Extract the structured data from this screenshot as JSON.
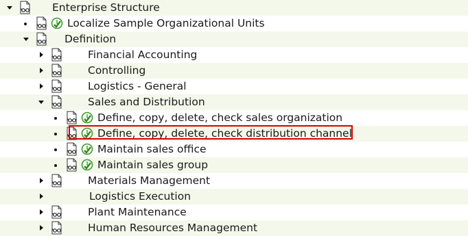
{
  "tree": {
    "root": {
      "label": "Enterprise Structure",
      "icon": "document-glasses-icon",
      "state": "expanded"
    },
    "items": [
      {
        "id": "localize",
        "label": "Localize Sample Organizational Units",
        "toggle": "leaf",
        "icon": "document-glasses-icon",
        "execute_icon": "execute-clock-check-icon"
      },
      {
        "id": "definition",
        "label": "Definition",
        "toggle": "expanded",
        "icon": "document-glasses-icon"
      },
      {
        "id": "financial-accounting",
        "label": "Financial Accounting",
        "toggle": "collapsed",
        "icon": "document-glasses-icon"
      },
      {
        "id": "controlling",
        "label": "Controlling",
        "toggle": "collapsed",
        "icon": "document-glasses-icon"
      },
      {
        "id": "logistics-general",
        "label": "Logistics - General",
        "toggle": "collapsed",
        "icon": "document-glasses-icon"
      },
      {
        "id": "sales-distribution",
        "label": "Sales and Distribution",
        "toggle": "expanded",
        "icon": "document-glasses-icon"
      },
      {
        "id": "define-sales-org",
        "label": "Define, copy, delete, check sales organization",
        "toggle": "leaf",
        "icon": "document-glasses-icon",
        "execute_icon": "execute-clock-check-icon"
      },
      {
        "id": "define-distribution-channel",
        "label": "Define, copy, delete, check distribution channel",
        "toggle": "leaf",
        "icon": "document-glasses-icon",
        "execute_icon": "execute-clock-check-icon",
        "highlighted": true
      },
      {
        "id": "maintain-sales-office",
        "label": "Maintain sales office",
        "toggle": "leaf",
        "icon": "document-glasses-icon",
        "execute_icon": "execute-clock-check-icon"
      },
      {
        "id": "maintain-sales-group",
        "label": "Maintain sales group",
        "toggle": "leaf",
        "icon": "document-glasses-icon",
        "execute_icon": "execute-clock-check-icon"
      },
      {
        "id": "materials-management",
        "label": "Materials Management",
        "toggle": "collapsed",
        "icon": "document-glasses-icon"
      },
      {
        "id": "logistics-execution",
        "label": "Logistics Execution",
        "toggle": "collapsed"
      },
      {
        "id": "plant-maintenance",
        "label": "Plant Maintenance",
        "toggle": "collapsed",
        "icon": "document-glasses-icon"
      },
      {
        "id": "hr-management",
        "label": "Human Resources Management",
        "toggle": "collapsed",
        "icon": "document-glasses-icon"
      }
    ]
  },
  "colors": {
    "row_alternate": "#f3f8ea",
    "highlight_border": "#d80000",
    "execute_green": "#3a9a2a"
  }
}
